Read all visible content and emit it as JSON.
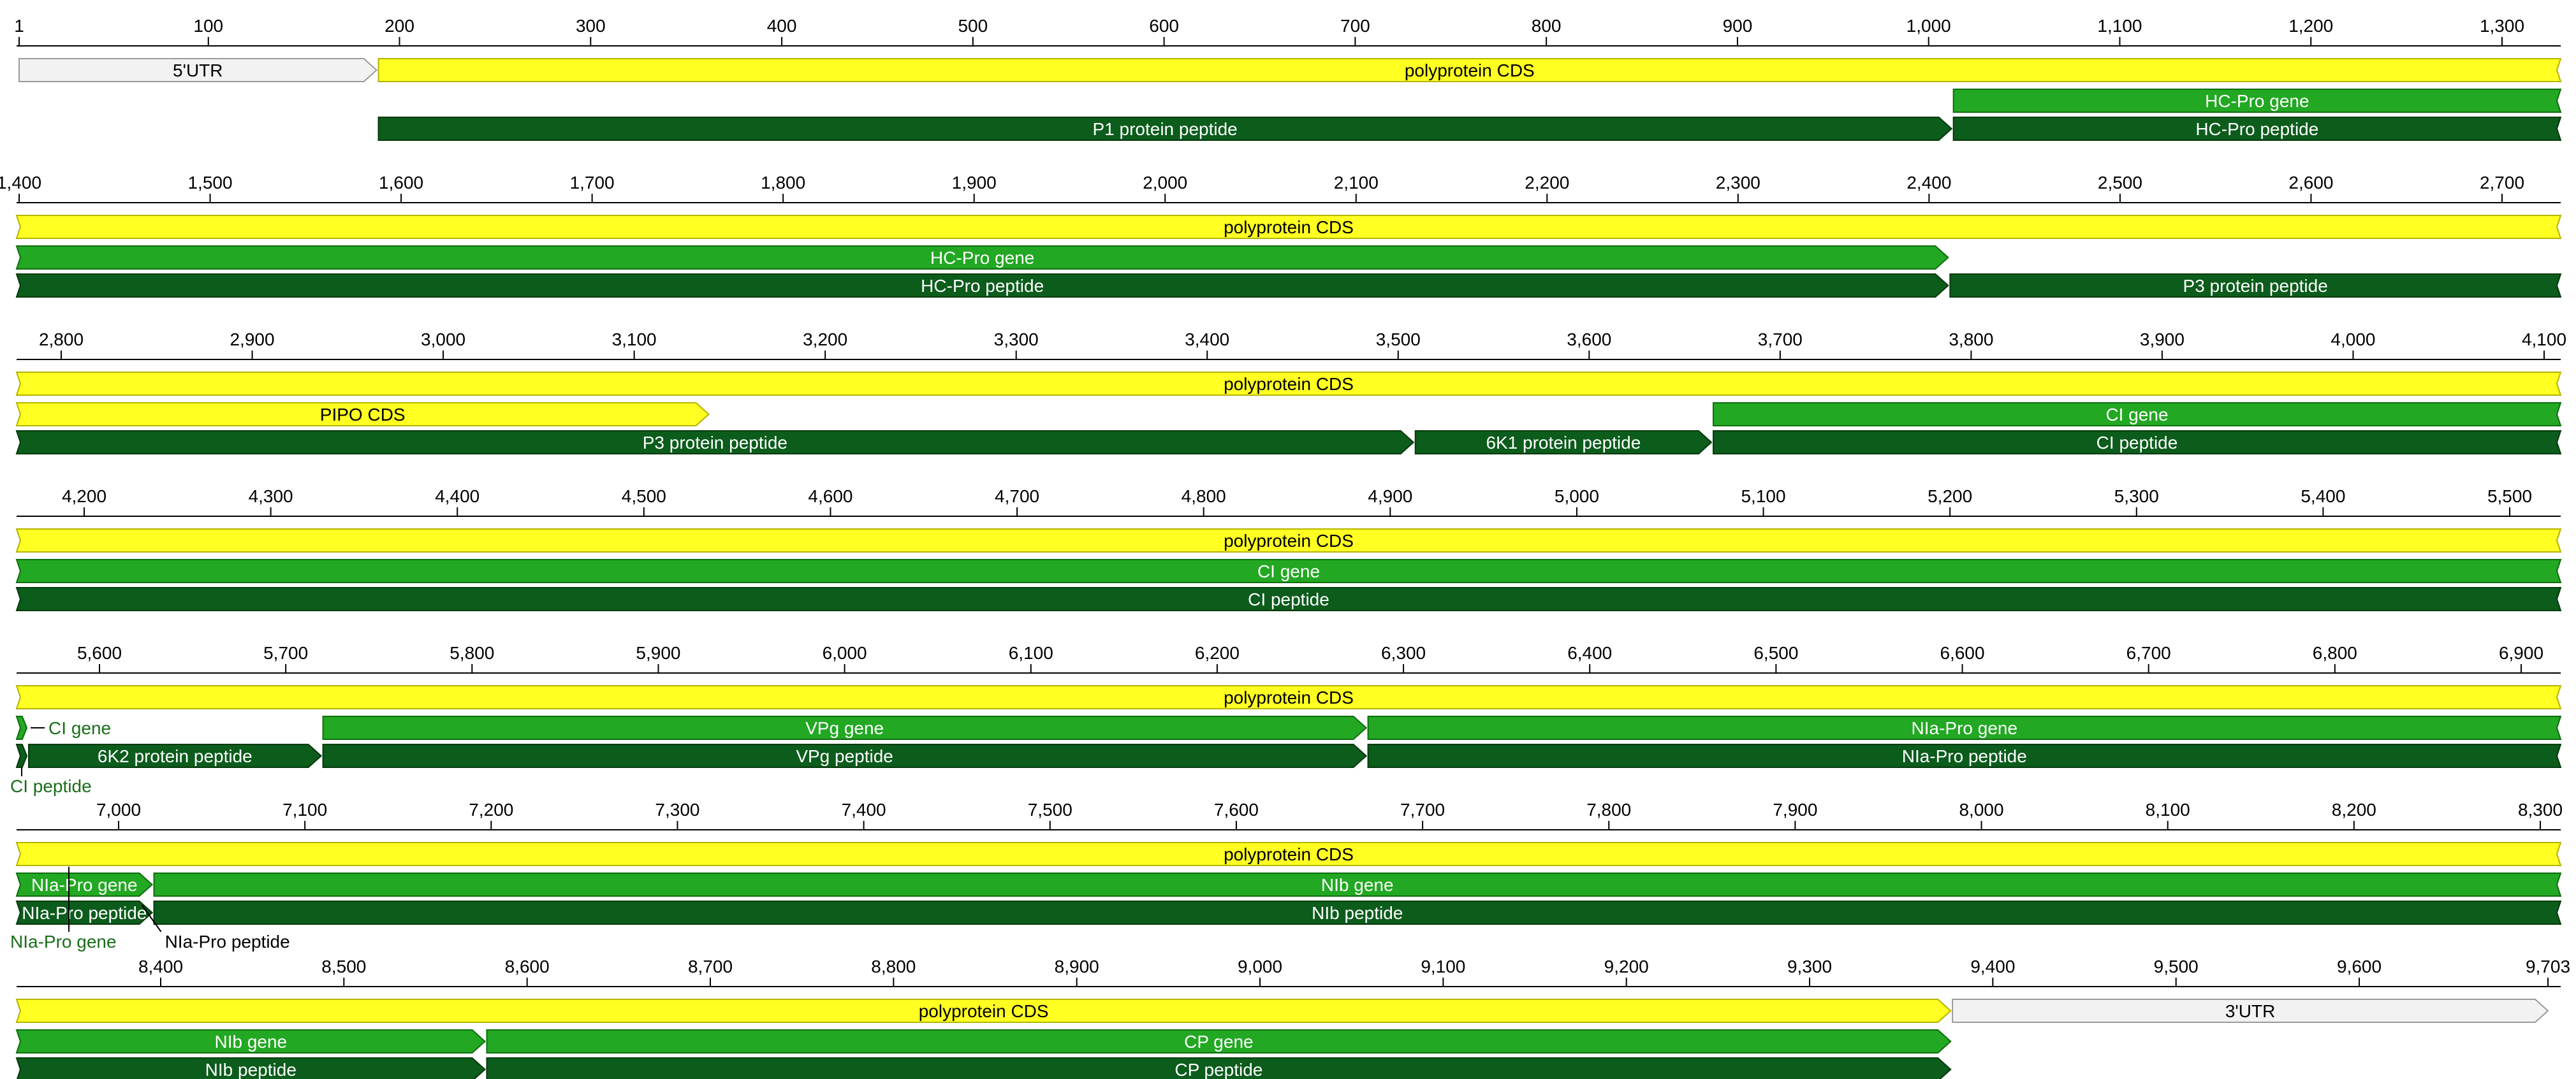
{
  "colors": {
    "cds": "#ffff22",
    "cds_stroke": "#b4b400",
    "gene": "#22a822",
    "gene_stroke": "#0e6e0e",
    "peptide": "#0c5c1c",
    "peptide_stroke": "#053a0c",
    "utr": "#f2f2f2",
    "utr_stroke": "#9a9a9a",
    "axis": "#000000",
    "label_on_dark": "#ffffff",
    "label_on_light": "#000000",
    "label_outside": "#1a6e1a"
  },
  "rows": [
    {
      "ticks": [
        {
          "pos": 1,
          "label": "1"
        },
        {
          "pos": 100,
          "label": "100"
        },
        {
          "pos": 200,
          "label": "200"
        },
        {
          "pos": 300,
          "label": "300"
        },
        {
          "pos": 400,
          "label": "400"
        },
        {
          "pos": 500,
          "label": "500"
        },
        {
          "pos": 600,
          "label": "600"
        },
        {
          "pos": 700,
          "label": "700"
        },
        {
          "pos": 800,
          "label": "800"
        },
        {
          "pos": 900,
          "label": "900"
        },
        {
          "pos": 1000,
          "label": "1,000"
        },
        {
          "pos": 1100,
          "label": "1,100"
        },
        {
          "pos": 1200,
          "label": "1,200"
        },
        {
          "pos": 1300,
          "label": "1,300"
        }
      ],
      "features": [
        {
          "name": "utr-5prime",
          "label": "5'UTR",
          "type": "utr",
          "start": 1,
          "end": 188,
          "track": 0,
          "open_start": false,
          "open_end": false
        },
        {
          "name": "polyprotein-cds-1",
          "label": "polyprotein CDS",
          "type": "cds",
          "start": 189,
          "end": 1387,
          "track": 0,
          "open_start": false,
          "open_end": true
        },
        {
          "name": "hc-pro-gene-1",
          "label": "HC-Pro gene",
          "type": "gene",
          "start": 1013,
          "end": 1387,
          "track": 1,
          "open_start": false,
          "open_end": true
        },
        {
          "name": "p1-protein-peptide",
          "label": "P1 protein peptide",
          "type": "peptide",
          "start": 189,
          "end": 1012,
          "track": 2,
          "open_start": false,
          "open_end": false
        },
        {
          "name": "hc-pro-peptide-1",
          "label": "HC-Pro peptide",
          "type": "peptide",
          "start": 1013,
          "end": 1387,
          "track": 2,
          "open_start": false,
          "open_end": true
        }
      ]
    },
    {
      "ticks": [
        {
          "pos": 1400,
          "label": "1,400"
        },
        {
          "pos": 1500,
          "label": "1,500"
        },
        {
          "pos": 1600,
          "label": "1,600"
        },
        {
          "pos": 1700,
          "label": "1,700"
        },
        {
          "pos": 1800,
          "label": "1,800"
        },
        {
          "pos": 1900,
          "label": "1,900"
        },
        {
          "pos": 2000,
          "label": "2,000"
        },
        {
          "pos": 2100,
          "label": "2,100"
        },
        {
          "pos": 2200,
          "label": "2,200"
        },
        {
          "pos": 2300,
          "label": "2,300"
        },
        {
          "pos": 2400,
          "label": "2,400"
        },
        {
          "pos": 2500,
          "label": "2,500"
        },
        {
          "pos": 2600,
          "label": "2,600"
        },
        {
          "pos": 2700,
          "label": "2,700"
        }
      ],
      "features": [
        {
          "name": "polyprotein-cds-2",
          "label": "polyprotein CDS",
          "type": "cds",
          "start": 1399,
          "end": 2775,
          "track": 0,
          "open_start": true,
          "open_end": true
        },
        {
          "name": "hc-pro-gene-2",
          "label": "HC-Pro gene",
          "type": "gene",
          "start": 1399,
          "end": 2410,
          "track": 1,
          "open_start": true,
          "open_end": false
        },
        {
          "name": "hc-pro-peptide-2",
          "label": "HC-Pro peptide",
          "type": "peptide",
          "start": 1399,
          "end": 2410,
          "track": 2,
          "open_start": true,
          "open_end": false
        },
        {
          "name": "p3-protein-peptide-1",
          "label": "P3 protein peptide",
          "type": "peptide",
          "start": 2411,
          "end": 2775,
          "track": 2,
          "open_start": false,
          "open_end": true
        }
      ]
    },
    {
      "ticks": [
        {
          "pos": 2800,
          "label": "2,800"
        },
        {
          "pos": 2900,
          "label": "2,900"
        },
        {
          "pos": 3000,
          "label": "3,000"
        },
        {
          "pos": 3100,
          "label": "3,100"
        },
        {
          "pos": 3200,
          "label": "3,200"
        },
        {
          "pos": 3300,
          "label": "3,300"
        },
        {
          "pos": 3400,
          "label": "3,400"
        },
        {
          "pos": 3500,
          "label": "3,500"
        },
        {
          "pos": 3600,
          "label": "3,600"
        },
        {
          "pos": 3700,
          "label": "3,700"
        },
        {
          "pos": 3800,
          "label": "3,800"
        },
        {
          "pos": 3900,
          "label": "3,900"
        },
        {
          "pos": 4000,
          "label": "4,000"
        },
        {
          "pos": 4100,
          "label": "4,100"
        }
      ],
      "features": [
        {
          "name": "polyprotein-cds-3",
          "label": "polyprotein CDS",
          "type": "cds",
          "start": 2775,
          "end": 4161,
          "track": 0,
          "open_start": true,
          "open_end": true
        },
        {
          "name": "pipo-cds",
          "label": "PIPO CDS",
          "type": "cds",
          "start": 2918,
          "end": 3139,
          "track": 1,
          "open_start": true,
          "open_end": false
        },
        {
          "name": "ci-gene-1",
          "label": "CI gene",
          "type": "gene",
          "start": 3665,
          "end": 4161,
          "track": 1,
          "open_start": false,
          "open_end": true
        },
        {
          "name": "p3-protein-peptide-2",
          "label": "P3 protein peptide",
          "type": "peptide",
          "start": 2775,
          "end": 3508,
          "track": 2,
          "open_start": true,
          "open_end": false
        },
        {
          "name": "6k1-protein-peptide",
          "label": "6K1 protein peptide",
          "type": "peptide",
          "start": 3509,
          "end": 3664,
          "track": 2,
          "open_start": false,
          "open_end": false
        },
        {
          "name": "ci-peptide-1",
          "label": "CI peptide",
          "type": "peptide",
          "start": 3665,
          "end": 4161,
          "track": 2,
          "open_start": false,
          "open_end": true
        }
      ]
    },
    {
      "ticks": [
        {
          "pos": 4200,
          "label": "4,200"
        },
        {
          "pos": 4300,
          "label": "4,300"
        },
        {
          "pos": 4400,
          "label": "4,400"
        },
        {
          "pos": 4500,
          "label": "4,500"
        },
        {
          "pos": 4600,
          "label": "4,600"
        },
        {
          "pos": 4700,
          "label": "4,700"
        },
        {
          "pos": 4800,
          "label": "4,800"
        },
        {
          "pos": 4900,
          "label": "4,900"
        },
        {
          "pos": 5000,
          "label": "5,000"
        },
        {
          "pos": 5100,
          "label": "5,100"
        },
        {
          "pos": 5200,
          "label": "5,200"
        },
        {
          "pos": 5300,
          "label": "5,300"
        },
        {
          "pos": 5400,
          "label": "5,400"
        },
        {
          "pos": 5500,
          "label": "5,500"
        }
      ],
      "features": [
        {
          "name": "polyprotein-cds-4",
          "label": "polyprotein CDS",
          "type": "cds",
          "start": 4164,
          "end": 5549,
          "track": 0,
          "open_start": true,
          "open_end": true
        },
        {
          "name": "ci-gene-2",
          "label": "CI gene",
          "type": "gene",
          "start": 4164,
          "end": 5549,
          "track": 1,
          "open_start": true,
          "open_end": true
        },
        {
          "name": "ci-peptide-2",
          "label": "CI peptide",
          "type": "peptide",
          "start": 4164,
          "end": 5549,
          "track": 2,
          "open_start": true,
          "open_end": true
        }
      ]
    },
    {
      "ticks": [
        {
          "pos": 5600,
          "label": "5,600"
        },
        {
          "pos": 5700,
          "label": "5,700"
        },
        {
          "pos": 5800,
          "label": "5,800"
        },
        {
          "pos": 5900,
          "label": "5,900"
        },
        {
          "pos": 6000,
          "label": "6,000"
        },
        {
          "pos": 6100,
          "label": "6,100"
        },
        {
          "pos": 6200,
          "label": "6,200"
        },
        {
          "pos": 6300,
          "label": "6,300"
        },
        {
          "pos": 6400,
          "label": "6,400"
        },
        {
          "pos": 6500,
          "label": "6,500"
        },
        {
          "pos": 6600,
          "label": "6,600"
        },
        {
          "pos": 6700,
          "label": "6,700"
        },
        {
          "pos": 6800,
          "label": "6,800"
        },
        {
          "pos": 6900,
          "label": "6,900"
        }
      ],
      "features": [
        {
          "name": "polyprotein-cds-5",
          "label": "polyprotein CDS",
          "type": "cds",
          "start": 5551,
          "end": 6937,
          "track": 0,
          "open_start": true,
          "open_end": true
        },
        {
          "name": "ci-gene-3",
          "label": "CI gene",
          "type": "gene",
          "start": 5551,
          "end": 5561,
          "track": 1,
          "open_start": true,
          "open_end": false
        },
        {
          "name": "vpg-gene",
          "label": "VPg gene",
          "type": "gene",
          "start": 5720,
          "end": 6280,
          "track": 1,
          "open_start": false,
          "open_end": false
        },
        {
          "name": "nia-pro-gene-1",
          "label": "NIa-Pro gene",
          "type": "gene",
          "start": 6281,
          "end": 6937,
          "track": 1,
          "open_start": false,
          "open_end": true
        },
        {
          "name": "ci-peptide-3",
          "label": "CI peptide",
          "type": "peptide",
          "start": 5551,
          "end": 5561,
          "track": 2,
          "open_start": true,
          "open_end": false
        },
        {
          "name": "6k2-protein-peptide",
          "label": "6K2 protein peptide",
          "type": "peptide",
          "start": 5562,
          "end": 5719,
          "track": 2,
          "open_start": false,
          "open_end": false
        },
        {
          "name": "vpg-peptide",
          "label": "VPg peptide",
          "type": "peptide",
          "start": 5720,
          "end": 6280,
          "track": 2,
          "open_start": false,
          "open_end": false
        },
        {
          "name": "nia-pro-peptide-1",
          "label": "NIa-Pro peptide",
          "type": "peptide",
          "start": 6281,
          "end": 6937,
          "track": 2,
          "open_start": false,
          "open_end": true
        }
      ],
      "callouts": [
        {
          "name": "ci-gene-callout",
          "label": "CI gene",
          "feature": "ci-gene-3",
          "side": "right"
        },
        {
          "name": "ci-peptide-callout",
          "label": "CI peptide",
          "feature": "ci-peptide-3",
          "side": "below"
        }
      ]
    },
    {
      "ticks": [
        {
          "pos": 7000,
          "label": "7,000"
        },
        {
          "pos": 7100,
          "label": "7,100"
        },
        {
          "pos": 7200,
          "label": "7,200"
        },
        {
          "pos": 7300,
          "label": "7,300"
        },
        {
          "pos": 7400,
          "label": "7,400"
        },
        {
          "pos": 7500,
          "label": "7,500"
        },
        {
          "pos": 7600,
          "label": "7,600"
        },
        {
          "pos": 7700,
          "label": "7,700"
        },
        {
          "pos": 7800,
          "label": "7,800"
        },
        {
          "pos": 7900,
          "label": "7,900"
        },
        {
          "pos": 8000,
          "label": "8,000"
        },
        {
          "pos": 8100,
          "label": "8,100"
        },
        {
          "pos": 8200,
          "label": "8,200"
        },
        {
          "pos": 8300,
          "label": "8,300"
        }
      ],
      "features": [
        {
          "name": "polyprotein-cds-6",
          "label": "polyprotein CDS",
          "type": "cds",
          "start": 6940,
          "end": 8326,
          "track": 0,
          "open_start": true,
          "open_end": true
        },
        {
          "name": "nia-pro-gene-2",
          "label": "NIa-Pro gene",
          "type": "gene",
          "start": 6940,
          "end": 7018,
          "track": 1,
          "open_start": true,
          "open_end": false
        },
        {
          "name": "nib-gene-1",
          "label": "NIb gene",
          "type": "gene",
          "start": 7019,
          "end": 8326,
          "track": 1,
          "open_start": false,
          "open_end": true
        },
        {
          "name": "nia-pro-peptide-2",
          "label": "NIa-Pro peptide",
          "type": "peptide",
          "start": 6940,
          "end": 7018,
          "track": 2,
          "open_start": true,
          "open_end": false
        },
        {
          "name": "nib-peptide-1",
          "label": "NIb peptide",
          "type": "peptide",
          "start": 7019,
          "end": 8326,
          "track": 2,
          "open_start": false,
          "open_end": true
        }
      ],
      "callouts": [
        {
          "name": "nia-pro-gene-callout",
          "label": "NIa-Pro gene",
          "feature": "nia-pro-gene-2",
          "side": "below-left"
        },
        {
          "name": "nia-pro-peptide-callout",
          "label": "NIa-Pro peptide",
          "feature": "nia-pro-peptide-2",
          "side": "below-right"
        }
      ]
    },
    {
      "ticks": [
        {
          "pos": 8400,
          "label": "8,400"
        },
        {
          "pos": 8500,
          "label": "8,500"
        },
        {
          "pos": 8600,
          "label": "8,600"
        },
        {
          "pos": 8700,
          "label": "8,700"
        },
        {
          "pos": 8800,
          "label": "8,800"
        },
        {
          "pos": 8900,
          "label": "8,900"
        },
        {
          "pos": 9000,
          "label": "9,000"
        },
        {
          "pos": 9100,
          "label": "9,100"
        },
        {
          "pos": 9200,
          "label": "9,200"
        },
        {
          "pos": 9300,
          "label": "9,300"
        },
        {
          "pos": 9400,
          "label": "9,400"
        },
        {
          "pos": 9500,
          "label": "9,500"
        },
        {
          "pos": 9600,
          "label": "9,600"
        },
        {
          "pos": 9703,
          "label": "9,703"
        }
      ],
      "features": [
        {
          "name": "polyprotein-cds-7",
          "label": "polyprotein CDS",
          "type": "cds",
          "start": 8329,
          "end": 9377,
          "track": 0,
          "open_start": true,
          "open_end": false
        },
        {
          "name": "utr-3prime",
          "label": "3'UTR",
          "type": "utr",
          "start": 9378,
          "end": 9703,
          "track": 0,
          "open_start": false,
          "open_end": false
        },
        {
          "name": "nib-gene-2",
          "label": "NIb gene",
          "type": "gene",
          "start": 8329,
          "end": 8577,
          "track": 1,
          "open_start": true,
          "open_end": false
        },
        {
          "name": "cp-gene",
          "label": "CP gene",
          "type": "gene",
          "start": 8578,
          "end": 9377,
          "track": 1,
          "open_start": false,
          "open_end": false
        },
        {
          "name": "nib-peptide-2",
          "label": "NIb peptide",
          "type": "peptide",
          "start": 8329,
          "end": 8577,
          "track": 2,
          "open_start": true,
          "open_end": false
        },
        {
          "name": "cp-peptide",
          "label": "CP peptide",
          "type": "peptide",
          "start": 8578,
          "end": 9377,
          "track": 2,
          "open_start": false,
          "open_end": false
        }
      ]
    }
  ]
}
